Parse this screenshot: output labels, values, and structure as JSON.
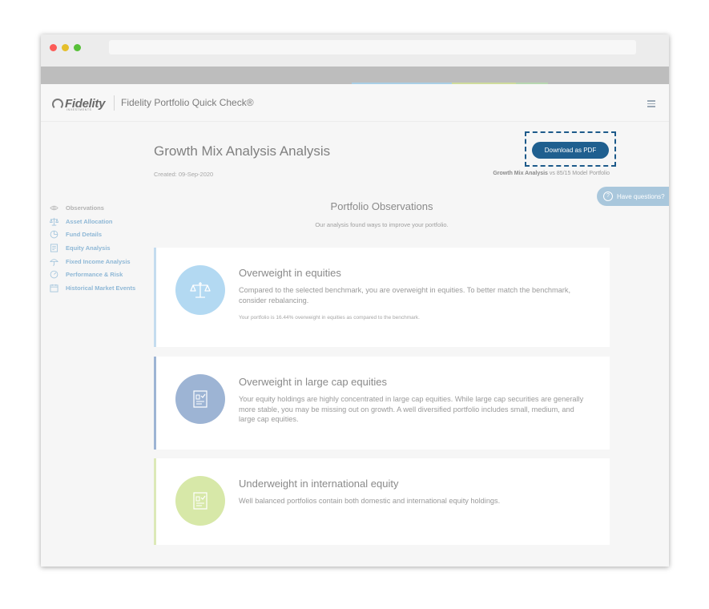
{
  "header": {
    "logo_text": "Fidelity",
    "logo_sub": "INVESTMENTS",
    "app_title": "Fidelity Portfolio Quick Check®"
  },
  "analysis": {
    "title": "Growth Mix Analysis Analysis",
    "created": "Created: 09-Sep-2020",
    "download_label": "Download as PDF",
    "benchmark_name": "Growth Mix Analysis",
    "benchmark_rest": " vs 85/15 Model Portfolio"
  },
  "help": {
    "label": "Have questions?",
    "glyph": "?"
  },
  "sidebar": {
    "items": [
      {
        "label": "Observations",
        "icon": "eye-icon"
      },
      {
        "label": "Asset Allocation",
        "icon": "scale-icon"
      },
      {
        "label": "Fund Details",
        "icon": "pie-chart-icon"
      },
      {
        "label": "Equity Analysis",
        "icon": "document-icon"
      },
      {
        "label": "Fixed Income Analysis",
        "icon": "umbrella-icon"
      },
      {
        "label": "Performance & Risk",
        "icon": "gauge-icon"
      },
      {
        "label": "Historical Market Events",
        "icon": "calendar-icon"
      }
    ]
  },
  "observations": {
    "title": "Portfolio Observations",
    "subtitle": "Our analysis found ways to improve your portfolio.",
    "cards": [
      {
        "title": "Overweight in equities",
        "text": "Compared to the selected benchmark, you are overweight in equities. To better match the benchmark, consider rebalancing.",
        "note": "Your portfolio is 16.44% overweight in equities as compared to the benchmark.",
        "icon": "scale-icon"
      },
      {
        "title": "Overweight in large cap equities",
        "text": "Your equity holdings are highly concentrated in large cap equities. While large cap securities are generally more stable, you may be missing out on growth. A well diversified portfolio includes small, medium, and large cap equities.",
        "icon": "document-check-icon"
      },
      {
        "title": "Underweight in international equity",
        "text": "Well balanced portfolios contain both domestic and international equity holdings.",
        "icon": "document-check-icon"
      }
    ]
  },
  "colors": {
    "accent": "#1f5f8f",
    "nav_active": "#8fb8d6",
    "card1": "#b3d9f2",
    "card2": "#9db4d4",
    "card3": "#d7e8a8",
    "card1_border": "#c4dcef",
    "card2_border": "#9db4d4",
    "card3_border": "#dce9b8"
  }
}
